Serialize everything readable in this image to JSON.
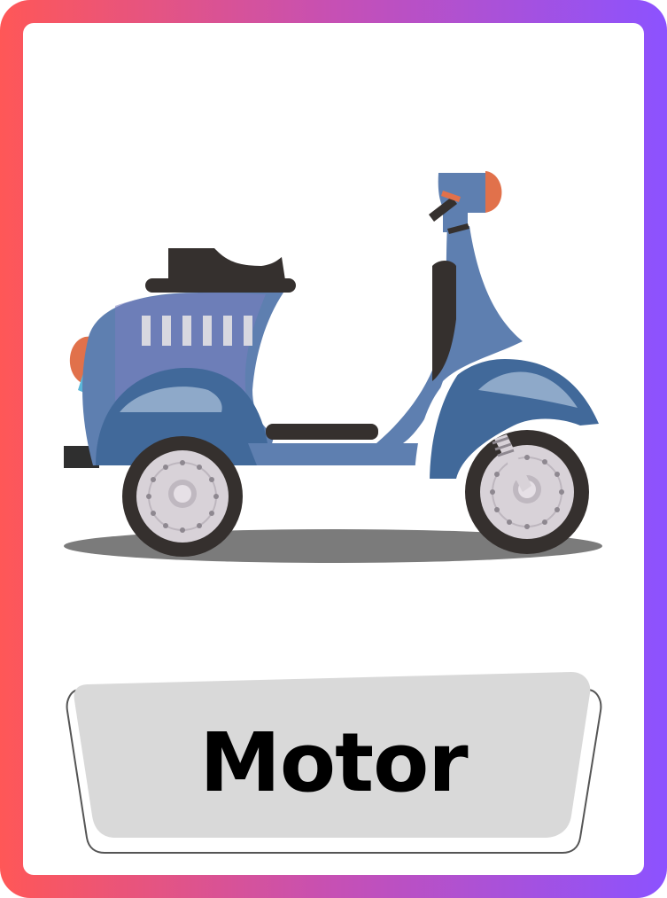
{
  "card": {
    "word": "Motor",
    "frame_colors": [
      "#ff5757",
      "#c650b4",
      "#8c52ff"
    ],
    "label_background": "#d9d9d9",
    "icon": "scooter-illustration"
  }
}
